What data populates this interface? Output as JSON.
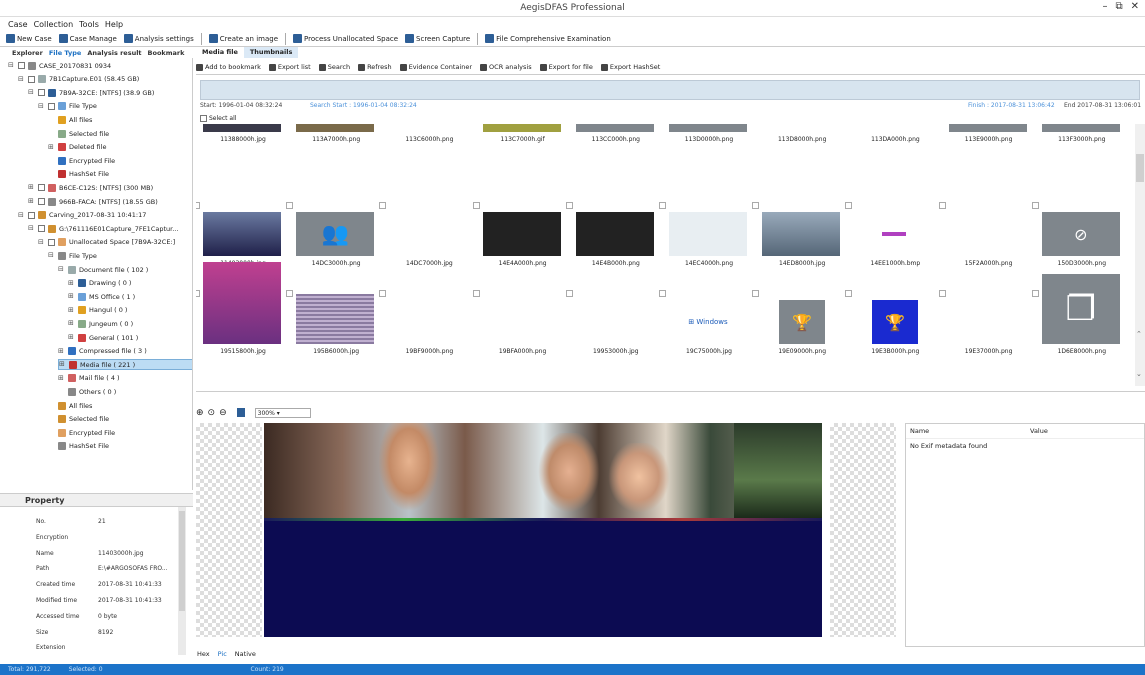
{
  "title": "AegisDFAS Professional",
  "window_controls": [
    "–",
    "⧉",
    "✕"
  ],
  "menu": [
    "Case",
    "Collection",
    "Tools",
    "Help"
  ],
  "toolbar": [
    {
      "label": "New Case",
      "icon": "new-case-icon"
    },
    {
      "label": "Case Manage",
      "icon": "case-manage-icon"
    },
    {
      "label": "Analysis settings",
      "icon": "settings-icon"
    },
    {
      "label": "Create an image",
      "icon": "image-icon"
    },
    {
      "label": "Process Unallocated Space",
      "icon": "process-icon"
    },
    {
      "label": "Screen Capture",
      "icon": "camera-icon"
    },
    {
      "label": "File Comprehensive Examination",
      "icon": "examine-icon"
    }
  ],
  "left_tabs": [
    "Explorer",
    "File Type",
    "Analysis result",
    "Bookmark"
  ],
  "tree": [
    {
      "label": "CASE_20170831 0934",
      "level": 0,
      "pm": "⊟"
    },
    {
      "label": "7B1Capture.E01 (58.45 GB)",
      "level": 1,
      "pm": "⊟"
    },
    {
      "label": "7B9A-32CE: [NTFS] (38.9 GB)",
      "level": 2,
      "pm": "⊟"
    },
    {
      "label": "File Type",
      "level": 3,
      "pm": "⊟"
    },
    {
      "label": "All files",
      "level": 4,
      "pm": ""
    },
    {
      "label": "Selected file",
      "level": 4,
      "pm": ""
    },
    {
      "label": "Deleted file",
      "level": 4,
      "pm": "⊞"
    },
    {
      "label": "Encrypted File",
      "level": 4,
      "pm": ""
    },
    {
      "label": "HashSet File",
      "level": 4,
      "pm": ""
    },
    {
      "label": "B6CE-C12S: [NTFS] (300 MB)",
      "level": 2,
      "pm": "⊞"
    },
    {
      "label": "966B-FACA: [NTFS] (18.55 GB)",
      "level": 2,
      "pm": "⊞"
    },
    {
      "label": "Carving_2017-08-31 10:41:17",
      "level": 1,
      "pm": "⊟"
    },
    {
      "label": "G:\\761116E01Capture_7FE1Captur...",
      "level": 2,
      "pm": "⊟"
    },
    {
      "label": "Unallocated Space [7B9A-32CE:]",
      "level": 3,
      "pm": "⊟"
    },
    {
      "label": "File Type",
      "level": 4,
      "pm": "⊟"
    },
    {
      "label": "Document file ( 102 )",
      "level": 5,
      "pm": "⊟"
    },
    {
      "label": "Drawing ( 0 )",
      "level": 6,
      "pm": "⊞"
    },
    {
      "label": "MS Office ( 1 )",
      "level": 6,
      "pm": "⊞"
    },
    {
      "label": "Hangul ( 0 )",
      "level": 6,
      "pm": "⊞"
    },
    {
      "label": "Jungeum ( 0 )",
      "level": 6,
      "pm": "⊞"
    },
    {
      "label": "General ( 101 )",
      "level": 6,
      "pm": "⊞"
    },
    {
      "label": "Compressed file ( 3 )",
      "level": 5,
      "pm": "⊞"
    },
    {
      "label": "Media file ( 221 )",
      "level": 5,
      "pm": "⊞",
      "selected": true
    },
    {
      "label": "Mail file ( 4 )",
      "level": 5,
      "pm": "⊞"
    },
    {
      "label": "Others ( 0 )",
      "level": 5,
      "pm": ""
    },
    {
      "label": "All files",
      "level": 4,
      "pm": ""
    },
    {
      "label": "Selected file",
      "level": 4,
      "pm": ""
    },
    {
      "label": "Encrypted File",
      "level": 4,
      "pm": ""
    },
    {
      "label": "HashSet File",
      "level": 4,
      "pm": ""
    }
  ],
  "property": {
    "title": "Property",
    "rows": [
      {
        "k": "No.",
        "v": "21"
      },
      {
        "k": "Encryption",
        "v": ""
      },
      {
        "k": "Name",
        "v": "11403000h.jpg"
      },
      {
        "k": "Path",
        "v": "E:\\#ARGOSOFAS FRO..."
      },
      {
        "k": "Created time",
        "v": "2017-08-31 10:41:33"
      },
      {
        "k": "Modified time",
        "v": "2017-08-31 10:41:33"
      },
      {
        "k": "Accessed time",
        "v": "0 byte"
      },
      {
        "k": "Size",
        "v": "8192"
      },
      {
        "k": "Extension",
        "v": ""
      }
    ]
  },
  "main_tabs": [
    "Media file",
    "Thumbnails"
  ],
  "action_toolbar": [
    "Add to bookmark",
    "Export list",
    "Search",
    "Refresh",
    "Evidence Container",
    "OCR analysis",
    "Export for file",
    "Export HashSet"
  ],
  "timeline": {
    "start": "Start: 1996-01-04 08:32:24",
    "search_start": "Search Start : 1996-01-04 08:32:24",
    "finish": "Finish : 2017-08-31 13:06:42",
    "end": "End  2017-08-31 13:06:01"
  },
  "select_all": "Select all",
  "thumbnails": [
    {
      "name": "11388000h.jpg",
      "row": 0,
      "col": 0
    },
    {
      "name": "113A7000h.png",
      "row": 0,
      "col": 1
    },
    {
      "name": "113C6000h.png",
      "row": 0,
      "col": 2
    },
    {
      "name": "113C7000h.gif",
      "row": 0,
      "col": 3
    },
    {
      "name": "113CC000h.png",
      "row": 0,
      "col": 4
    },
    {
      "name": "113D0000h.png",
      "row": 0,
      "col": 5
    },
    {
      "name": "113D8000h.png",
      "row": 0,
      "col": 6
    },
    {
      "name": "113DA000h.png",
      "row": 0,
      "col": 7
    },
    {
      "name": "113E9000h.png",
      "row": 0,
      "col": 8
    },
    {
      "name": "113F3000h.png",
      "row": 0,
      "col": 9
    },
    {
      "name": "11403000h.jpg",
      "row": 1,
      "col": 0
    },
    {
      "name": "14DC3000h.png",
      "row": 1,
      "col": 1
    },
    {
      "name": "14DC7000h.jpg",
      "row": 1,
      "col": 2
    },
    {
      "name": "14E4A000h.png",
      "row": 1,
      "col": 3
    },
    {
      "name": "14E4B000h.png",
      "row": 1,
      "col": 4
    },
    {
      "name": "14EC4000h.png",
      "row": 1,
      "col": 5
    },
    {
      "name": "14ED8000h.jpg",
      "row": 1,
      "col": 6
    },
    {
      "name": "14EE1000h.bmp",
      "row": 1,
      "col": 7
    },
    {
      "name": "15F2A000h.png",
      "row": 1,
      "col": 8
    },
    {
      "name": "150D3000h.png",
      "row": 1,
      "col": 9
    },
    {
      "name": "19515800h.jpg",
      "row": 2,
      "col": 0
    },
    {
      "name": "195B6000h.jpg",
      "row": 2,
      "col": 1
    },
    {
      "name": "19BF9000h.png",
      "row": 2,
      "col": 2
    },
    {
      "name": "19BFA000h.png",
      "row": 2,
      "col": 3
    },
    {
      "name": "19953000h.jpg",
      "row": 2,
      "col": 4
    },
    {
      "name": "19C75000h.jpg",
      "row": 2,
      "col": 5
    },
    {
      "name": "19E09000h.png",
      "row": 2,
      "col": 6
    },
    {
      "name": "19E3B000h.png",
      "row": 2,
      "col": 7
    },
    {
      "name": "19E37000h.png",
      "row": 2,
      "col": 8
    },
    {
      "name": "1D6E8000h.png",
      "row": 2,
      "col": 9
    }
  ],
  "viewer": {
    "zoom": "300%"
  },
  "exif": {
    "col_name": "Name",
    "col_value": "Value",
    "message": "No Exif metadata found"
  },
  "viewer_tabs": [
    "Hex",
    "Pic",
    "Native"
  ],
  "status": {
    "total": "Total: 291,722",
    "selected": "Selected: 0",
    "count": "Count: 219"
  }
}
